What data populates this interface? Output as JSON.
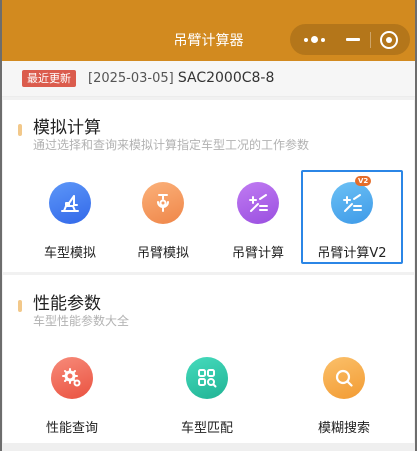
{
  "window": {
    "title": "吊臂计算器",
    "capsule_icons": [
      "more-dots-icon",
      "minimize-icon",
      "close-target-icon"
    ]
  },
  "update": {
    "badge": "最近更新",
    "date": "[2025-03-05]",
    "model": "SAC2000C8-8"
  },
  "sections": [
    {
      "title": "模拟计算",
      "subtitle": "通过选择和查询来模拟计算指定车型工况的工作参数",
      "items": [
        {
          "label": "车型模拟",
          "icon": "crane-icon",
          "color": "#3f78f0"
        },
        {
          "label": "吊臂模拟",
          "icon": "hook-icon",
          "color": "#f39a62"
        },
        {
          "label": "吊臂计算",
          "icon": "calculator-icon",
          "color": "#a95de8"
        },
        {
          "label": "吊臂计算V2",
          "icon": "calculator-icon",
          "color": "#46a8ef",
          "badge": "V2",
          "selected": true
        }
      ]
    },
    {
      "title": "性能参数",
      "subtitle": "车型性能参数大全",
      "items": [
        {
          "label": "性能查询",
          "icon": "settings-icon",
          "color": "#ee5f50"
        },
        {
          "label": "车型匹配",
          "icon": "grid-search-icon",
          "color": "#2ec5a5"
        },
        {
          "label": "模糊搜索",
          "icon": "search-icon",
          "color": "#f5a845"
        }
      ]
    }
  ]
}
